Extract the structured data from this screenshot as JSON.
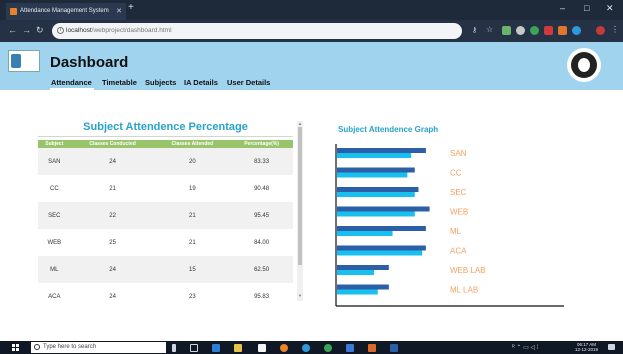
{
  "browser": {
    "tab_title": "Attendance Management System",
    "url_host": "localhost",
    "url_path": "/webproject/dashboard.html"
  },
  "header": {
    "title": "Dashboard",
    "nav": [
      "Attendance",
      "Timetable",
      "Subjects",
      "IA Details",
      "User Details"
    ],
    "active_nav": "Attendance"
  },
  "table": {
    "title": "Subject Attendence Percentage",
    "columns": [
      "Subject",
      "Classes Conducted",
      "Classes Attended",
      "Percentage(%)"
    ],
    "rows": [
      [
        "SAN",
        "24",
        "20",
        "83.33"
      ],
      [
        "CC",
        "21",
        "19",
        "90.48"
      ],
      [
        "SEC",
        "22",
        "21",
        "95.45"
      ],
      [
        "WEB",
        "25",
        "21",
        "84.00"
      ],
      [
        "ML",
        "24",
        "15",
        "62.50"
      ],
      [
        "ACA",
        "24",
        "23",
        "95.83"
      ]
    ]
  },
  "graph": {
    "title": "Subject Attendence Graph"
  },
  "chart_data": {
    "type": "bar",
    "orientation": "horizontal",
    "categories": [
      "SAN",
      "CC",
      "SEC",
      "WEB",
      "ML",
      "ACA",
      "WEB LAB",
      "ML LAB"
    ],
    "series": [
      {
        "values": [
          24,
          21,
          22,
          25,
          24,
          24,
          14,
          14
        ],
        "color": "#2b5fa8"
      },
      {
        "values": [
          20,
          19,
          21,
          21,
          15,
          23,
          10,
          11
        ],
        "color": "#18c0ef"
      }
    ],
    "xlim": [
      0,
      27
    ],
    "grid": false,
    "label_color": "#f5a15e"
  },
  "taskbar": {
    "search_placeholder": "Type here to search",
    "time": "06:17 AM",
    "date": "12-12-2019"
  }
}
